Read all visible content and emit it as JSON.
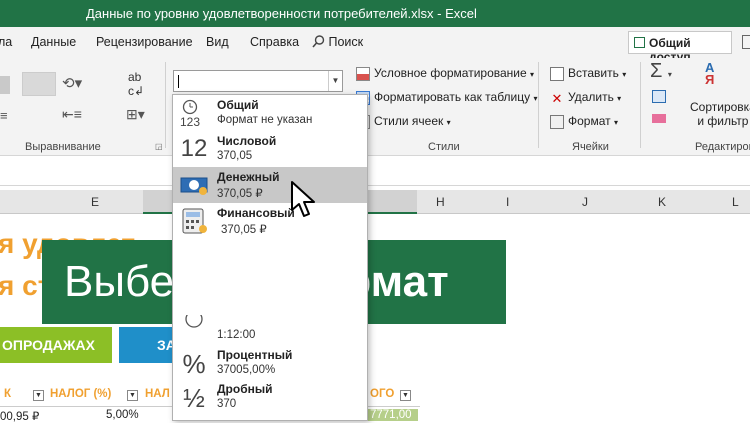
{
  "title_bar": {
    "title": "Данные по уровню удовлетворенности потребителей.xlsx  -  Excel"
  },
  "ribbon_tabs": [
    {
      "label": "ла"
    },
    {
      "label": "Данные"
    },
    {
      "label": "Рецензирование"
    },
    {
      "label": "Вид"
    },
    {
      "label": "Справка"
    },
    {
      "label": "Поиск"
    }
  ],
  "share_button": {
    "label": "Общий доступ"
  },
  "ribbon": {
    "alignment_group": "Выравнивание",
    "styles_group": "Стили",
    "cells_group": "Ячейки",
    "editing_group": "Редактирова",
    "conditional_formatting": "Условное форматирование",
    "format_as_table": "Форматировать как таблицу",
    "cell_styles": "Стили ячеек",
    "insert": "Вставить",
    "delete": "Удалить",
    "format": "Формат",
    "sort_filter_1": "Сортировка",
    "sort_filter_2": "и фильтр"
  },
  "format_dropdown": {
    "items": [
      {
        "name": "Общий",
        "example": "Формат не указан",
        "icon": "clock-123-icon"
      },
      {
        "name": "Числовой",
        "example": "370,05",
        "icon": "number-12-icon"
      },
      {
        "name": "Денежный",
        "example": "370,05 ₽",
        "icon": "money-icon",
        "highlighted": true
      },
      {
        "name": "Финансовый",
        "example": "370,05 ₽",
        "icon": "calculator-icon"
      },
      {
        "name": "",
        "example": "1:12:00",
        "icon": "clock-icon"
      },
      {
        "name": "Процентный",
        "example": "37005,00%",
        "icon": "percent-icon"
      },
      {
        "name": "Дробный",
        "example": "370",
        "icon": "fraction-icon"
      }
    ]
  },
  "columns": [
    "E",
    "H",
    "I",
    "J",
    "K",
    "L"
  ],
  "sheet": {
    "heading_line1": "я удовлет",
    "heading_line2": "я ст",
    "btn_sales": "ОПРОДАЖАХ",
    "btn_second": "ЗА",
    "col_header_k": "К",
    "col_header_tax": "НАЛОГ (%)",
    "col_header_nal": "НАЛ",
    "col_header_ogo": "ОГО",
    "row_val_1": "00,95 ₽",
    "row_val_2": "5,00%",
    "row_val_3": "7771,00"
  },
  "banner": {
    "text_regular": "Выберите",
    "text_bold": "формат"
  },
  "colors": {
    "excel_green": "#217346",
    "orange": "#f0a030",
    "blue": "#1f8fc9",
    "lime": "#8cbf26"
  }
}
